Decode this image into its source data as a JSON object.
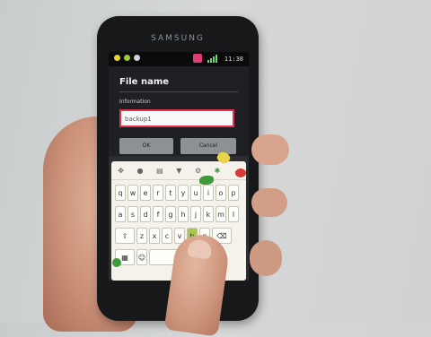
{
  "phone": {
    "brand": "SAMSUNG",
    "status_time": "11:38"
  },
  "dialog": {
    "title": "File name",
    "info_label": "Information",
    "filename_value": "backup1",
    "ok_label": "OK",
    "cancel_label": "Cancel"
  },
  "keyboard": {
    "row1": [
      "q",
      "w",
      "e",
      "r",
      "t",
      "y",
      "u",
      "i",
      "o",
      "p"
    ],
    "row2": [
      "a",
      "s",
      "d",
      "f",
      "g",
      "h",
      "j",
      "k",
      "m",
      "l"
    ],
    "row3": [
      "z",
      "x",
      "c",
      "v",
      "b",
      "n"
    ],
    "toolbar_icons": [
      "arrows-icon",
      "mic-icon",
      "clipboard-icon",
      "shirt-icon",
      "gear-icon",
      "splat-icon",
      "chevron-down-icon"
    ]
  },
  "colors": {
    "input_border": "#e5324f",
    "key_highlight": "#a8c84a"
  }
}
